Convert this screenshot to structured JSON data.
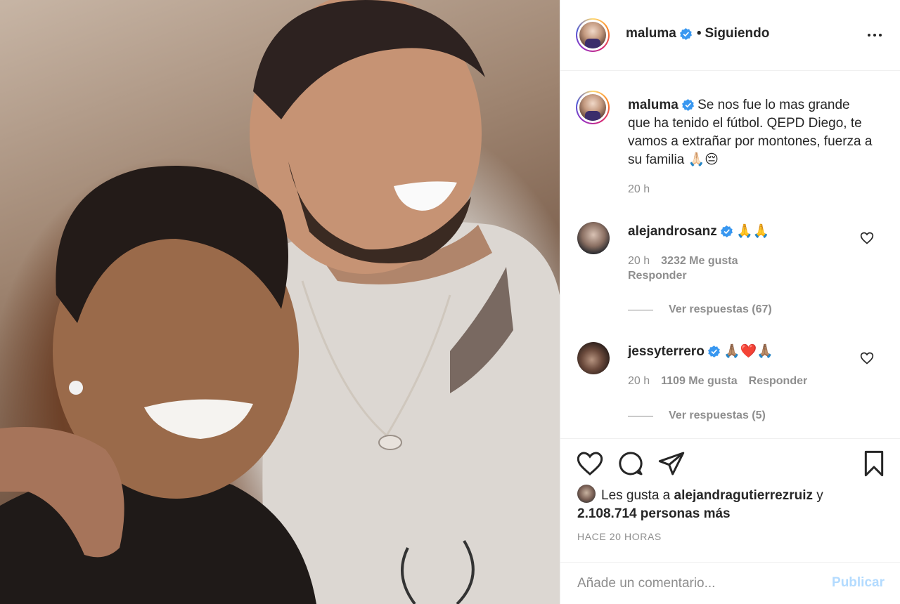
{
  "post": {
    "author": "maluma",
    "follow_state": "Siguiendo",
    "separator": "•"
  },
  "caption": {
    "author": "maluma",
    "text": " Se nos fue lo mas grande que ha tenido el fútbol. QEPD Diego, te vamos a extrañar por montones, fuerza a su familia 🙏🏻😔",
    "time": "20 h"
  },
  "comments": [
    {
      "author": "alejandrosanz",
      "text": " 🙏🙏",
      "time": "20 h",
      "likes": "3232 Me gusta",
      "reply_label": "Responder",
      "view_replies": "Ver respuestas (67)"
    },
    {
      "author": "jessyterrero",
      "text": " 🙏🏽❤️🙏🏽",
      "time": "20 h",
      "likes": "1109 Me gusta",
      "reply_label": "Responder",
      "view_replies": "Ver respuestas (5)"
    }
  ],
  "likes": {
    "prefix": "Les gusta a ",
    "user": "alejandragutierrezruiz",
    "connector": " y",
    "count": "2.108.714 personas más"
  },
  "timestamp": "HACE 20 HORAS",
  "add_comment": {
    "placeholder": "Añade un comentario...",
    "publish_label": "Publicar"
  },
  "icons": {
    "verified": "verified-badge-icon",
    "more": "more-options-icon",
    "like": "heart-icon",
    "comment": "comment-icon",
    "share": "share-icon",
    "save": "bookmark-icon"
  },
  "colors": {
    "verified": "#3897f0",
    "link_disabled": "#b3dbff",
    "muted": "#8e8e8e",
    "text": "#262626"
  }
}
